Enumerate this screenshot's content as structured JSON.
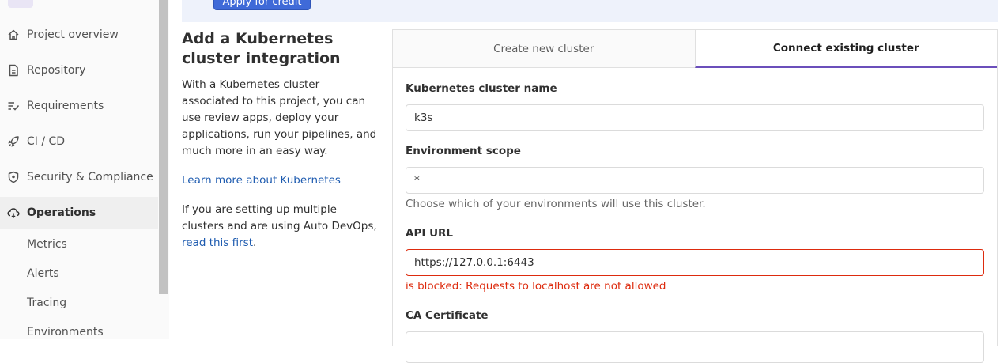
{
  "sidebar": {
    "items": [
      {
        "label": "Project overview",
        "icon": "home-icon"
      },
      {
        "label": "Repository",
        "icon": "document-icon"
      },
      {
        "label": "Requirements",
        "icon": "requirements-icon"
      },
      {
        "label": "CI / CD",
        "icon": "rocket-icon"
      },
      {
        "label": "Security & Compliance",
        "icon": "shield-icon"
      },
      {
        "label": "Operations",
        "icon": "cloud-gear-icon",
        "active": true
      }
    ],
    "subitems": [
      "Metrics",
      "Alerts",
      "Tracing",
      "Environments"
    ],
    "accent_color": "#6b4fbb"
  },
  "banner": {
    "button_label": "Apply for credit"
  },
  "intro": {
    "title": "Add a Kubernetes cluster integration",
    "description": "With a Kubernetes cluster associated to this project, you can use review apps, deploy your applications, run your pipelines, and much more in an easy way.",
    "learn_more": "Learn more about Kubernetes",
    "autodevops_text": "If you are setting up multiple clusters and are using Auto DevOps,",
    "autodevops_link": "read this first",
    "autodevops_end": "."
  },
  "tabs": [
    {
      "label": "Create new cluster",
      "active": false
    },
    {
      "label": "Connect existing cluster",
      "active": true
    }
  ],
  "form": {
    "cluster_name_label": "Kubernetes cluster name",
    "cluster_name_value": "k3s",
    "env_scope_label": "Environment scope",
    "env_scope_value": "*",
    "env_scope_help": "Choose which of your environments will use this cluster.",
    "api_url_label": "API URL",
    "api_url_value": "https://127.0.0.1:6443",
    "api_url_error": "is blocked: Requests to localhost are not allowed",
    "ca_cert_label": "CA Certificate"
  },
  "colors": {
    "error": "#dd2b0e",
    "link": "#1f5cb0",
    "button": "#3f6ad8"
  }
}
